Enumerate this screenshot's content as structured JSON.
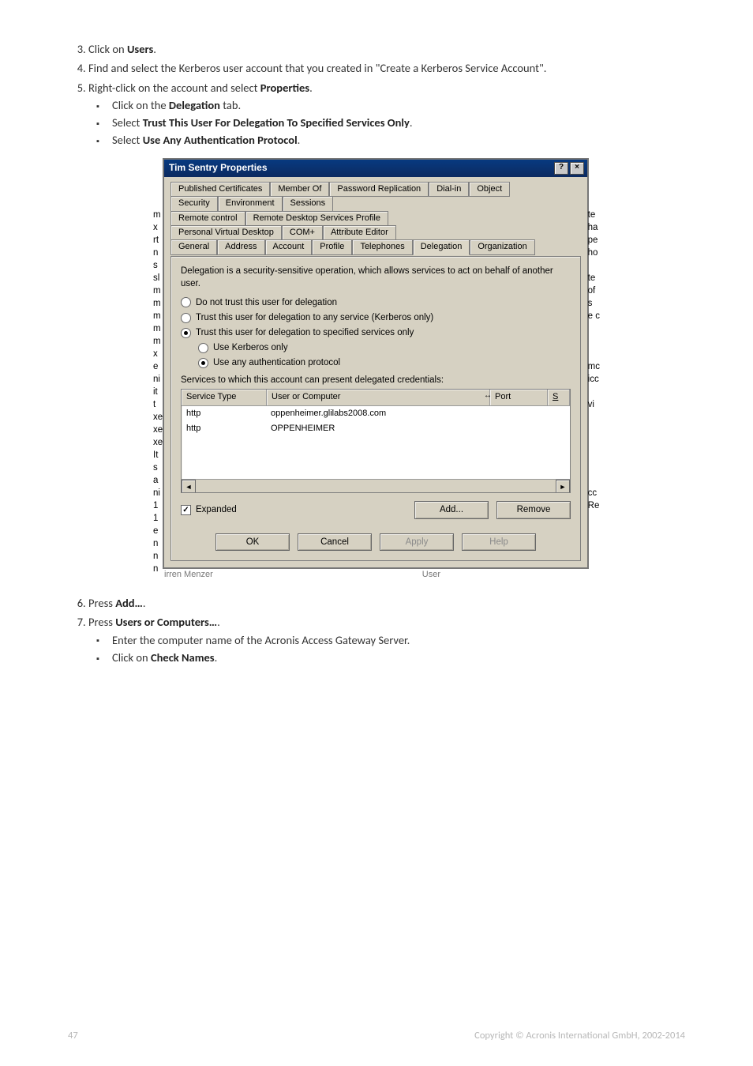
{
  "steps": {
    "s3": "Click on ",
    "s3_bold": "Users",
    "s3_tail": ".",
    "s4": "Find and select the Kerberos user account that you created in \"Create a Kerberos Service Account\".",
    "s5": "Right-click on the account and select ",
    "s5_bold": "Properties",
    "s5_tail": ".",
    "s5_b1_a": "Click on the ",
    "s5_b1_bold": "Delegation",
    "s5_b1_b": " tab.",
    "s5_b2_a": "Select ",
    "s5_b2_bold": "Trust This User For Delegation To Specified Services Only",
    "s5_b2_b": ".",
    "s5_b3_a": "Select ",
    "s5_b3_bold": "Use Any Authentication Protocol",
    "s5_b3_b": ".",
    "s6": "Press ",
    "s6_bold": "Add…",
    "s6_tail": ".",
    "s7": "Press ",
    "s7_bold": "Users or Computers…",
    "s7_tail": ".",
    "s7_b1": "Enter the computer name of the Acronis Access Gateway Server.",
    "s7_b2_a": "Click on ",
    "s7_b2_bold": "Check Names",
    "s7_b2_b": "."
  },
  "dialog": {
    "title": "Tim Sentry Properties",
    "help_btn": "?",
    "close_btn": "×",
    "tab_rows": [
      [
        "Published Certificates",
        "Member Of",
        "Password Replication",
        "Dial-in",
        "Object"
      ],
      [
        "Security",
        "Environment",
        "Sessions"
      ],
      [
        "Remote control",
        "Remote Desktop Services Profile"
      ],
      [
        "Personal Virtual Desktop",
        "COM+",
        "Attribute Editor"
      ],
      [
        "General",
        "Address",
        "Account",
        "Profile",
        "Telephones",
        "Delegation",
        "Organization"
      ]
    ],
    "active_tab": "Delegation",
    "intro": "Delegation is a security-sensitive operation, which allows services to act on behalf of another user.",
    "r1": "Do not trust this user for delegation",
    "r2": "Trust this user for delegation to any service (Kerberos only)",
    "r3": "Trust this user for delegation to specified services only",
    "r4": "Use Kerberos only",
    "r5": "Use any authentication protocol",
    "services_label": "Services to which this account can present delegated credentials:",
    "cols": {
      "svc": "Service Type",
      "comp": "User or Computer",
      "port": "Port",
      "last": "S"
    },
    "rows": [
      {
        "svc": "http",
        "comp": "oppenheimer.glilabs2008.com"
      },
      {
        "svc": "http",
        "comp": "OPPENHEIMER"
      }
    ],
    "expanded": "Expanded",
    "add": "Add...",
    "remove": "Remove",
    "ok": "OK",
    "cancel": "Cancel",
    "apply": "Apply",
    "help": "Help"
  },
  "statusbar": {
    "left": "irren Menzer",
    "right": "User"
  },
  "edge_left_text": "m\nx\nrt\nn\ns\nsl\nm\nm\nm\nm\nm\nx\ne\nni\nit\nt\nxe\nxe\nxe\nIt\ns\na\nni\n1\n1\ne\nn\nn\nn",
  "edge_right_text": "te\nha\npe\nho\n\nte\nof\ns\ne c\n\n\n\nmc\nicc\n\nvi\n\n\n\n\n\n\ncc\nRe",
  "footer": {
    "page": "47",
    "copyright": "Copyright © Acronis International GmbH, 2002-2014"
  }
}
